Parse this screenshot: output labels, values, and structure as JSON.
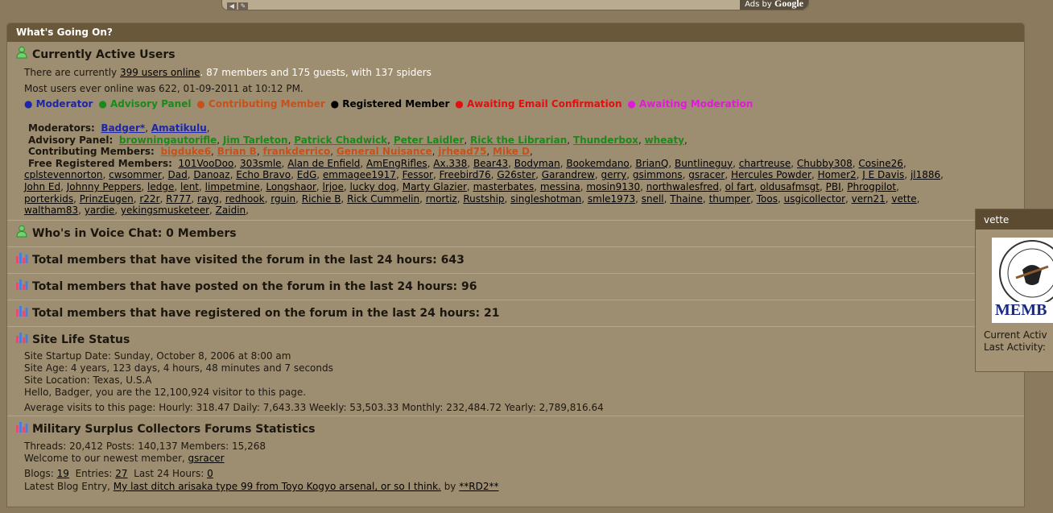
{
  "topbar": {
    "ads_label": "Ads by",
    "ads_brand": "Google"
  },
  "panel": {
    "title": "What's Going On?"
  },
  "active_users": {
    "title": "Currently Active Users",
    "line1_prefix": "There are currently ",
    "line1_link": "399 users online",
    "line1_suffix": ". 87 members and 175 guests, with 137 spiders",
    "line2": "Most users ever online was 622, 01-09-2011 at 10:12 PM.",
    "legend": [
      {
        "label": "● Moderator",
        "cls": "mod"
      },
      {
        "label": "● Advisory Panel",
        "cls": "adv"
      },
      {
        "label": "● Contributing Member",
        "cls": "con"
      },
      {
        "label": "● Registered Member",
        "cls": "reg"
      },
      {
        "label": "● Awaiting Email Confirmation",
        "cls": "awe"
      },
      {
        "label": "● Awaiting Moderation",
        "cls": "awm"
      }
    ],
    "moderators_label": "Moderators:",
    "moderators": [
      "Badger*",
      "Amatikulu"
    ],
    "advisory_label": "Advisory Panel:",
    "advisory": [
      "browningautorifle",
      "Jim Tarleton",
      "Patrick Chadwick",
      "Peter Laidler",
      "Rick the Librarian",
      "Thunderbox",
      "wheaty"
    ],
    "contributing_label": "Contributing Members:",
    "contributing": [
      "bigduke6",
      "Brian B",
      "frankderrico",
      "General Nuisance",
      "jrhead75",
      "Mike D"
    ],
    "free_label": "Free Registered Members:",
    "free_lines": [
      [
        "101VooDoo",
        "303smle",
        "Alan de Enfield",
        "AmEngRifles",
        "Ax.338",
        "Bear43",
        "Bodyman",
        "Bookemdano",
        "BrianQ",
        "Buntlineguy",
        "chartreuse",
        "Chubby308",
        "Cosine26"
      ],
      [
        "cplstevennorton",
        "cwsommer",
        "Dad",
        "Danoaz",
        "Echo Bravo",
        "EdG",
        "emmagee1917",
        "Fessor",
        "Freebird76",
        "G26ster",
        "Garandrew",
        "gerry",
        "gsimmons",
        "gsracer",
        "Hercules Powder",
        "Homer2",
        "J E Davis",
        "jl1886"
      ],
      [
        "John Ed",
        "Johnny Peppers",
        "ledge",
        "lent",
        "limpetmine",
        "Longshaor",
        "lrjoe",
        "lucky dog",
        "Marty Glazier",
        "masterbates",
        "messina",
        "mosin9130",
        "northwalesfred",
        "ol fart",
        "oldusafmsgt",
        "PBI",
        "Phrogpilot"
      ],
      [
        "porterkids",
        "PrinzEugen",
        "r22r",
        "R777",
        "rayg",
        "redhook",
        "rguin",
        "Richie B",
        "Rick Cummelin",
        "rnortiz",
        "Rustship",
        "singleshotman",
        "smle1973",
        "snell",
        "Thaine",
        "thumper",
        "Toos",
        "usgicollector",
        "vern21",
        "vette"
      ],
      [
        "waltham83",
        "yardie",
        "yekingsmusketeer",
        "Zaidin"
      ]
    ]
  },
  "voice_chat": {
    "title": "Who's in Voice Chat: 0 Members"
  },
  "visited": {
    "title": "Total members that have visited the forum in the last 24 hours: 643"
  },
  "posted": {
    "title": "Total members that have posted on the forum in the last 24 hours: 96"
  },
  "registered": {
    "title": "Total members that have registered on the forum in the last 24 hours: 21"
  },
  "site_life": {
    "title": "Site Life Status",
    "startup": "Site Startup Date: Sunday, October 8, 2006 at 8:00 am",
    "age": "Site Age: 4 years, 123 days, 4 hours, 48 minutes and 7 seconds",
    "location": "Site Location: Texas, U.S.A",
    "hello": "Hello, Badger, you are the 12,100,924 visitor to this page.",
    "averages": "Average visits to this page: Hourly: 318.47  Daily: 7,643.33  Weekly: 53,503.33  Monthly: 232,484.72  Yearly: 2,789,816.64"
  },
  "stats": {
    "title": "Military Surplus Collectors Forums Statistics",
    "threads": "Threads: 20,412  Posts: 140,137  Members: 15,268",
    "welcome_prefix": "Welcome to our newest member, ",
    "newest_member": "gsracer",
    "blogs_prefix": "Blogs: ",
    "blogs": "19",
    "entries_prefix": "Entries: ",
    "entries": "27",
    "last24_prefix": "Last 24 Hours: ",
    "last24": "0",
    "latest_prefix": "Latest Blog Entry, ",
    "latest_link": "My last ditch arisaka type 99 from Toyo Kogyo arsenal, or so I think.",
    "latest_by": " by ",
    "latest_author": "**RD2**"
  },
  "popup": {
    "name": "vette",
    "avatar_text": "MEMB",
    "current_activity": "Current Activ",
    "last_activity": "Last Activity:"
  },
  "colors": {
    "panel_bg": "#9e8e71",
    "header_bg": "#6a583b",
    "moderator": "#1d25a8",
    "advisory": "#1a8a1a",
    "contributing": "#c8501a",
    "awaiting_email": "#e01010",
    "awaiting_moderation": "#e01ad8"
  }
}
